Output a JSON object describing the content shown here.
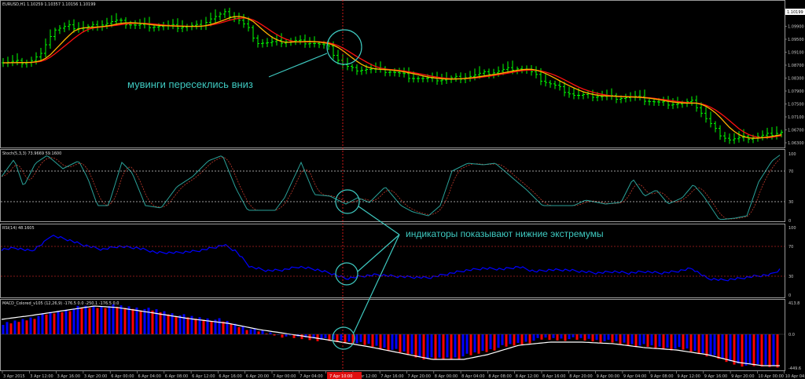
{
  "header": {
    "symbol_title": "EURUSD,H1  1.10259 1.10357 1.10156 1.10199"
  },
  "price_pane": {
    "current_price_badge": "1.10199",
    "price_axis": [
      "1.10300",
      "1.09900",
      "1.09500",
      "1.09100",
      "1.08700",
      "1.08300",
      "1.07900",
      "1.07500",
      "1.07100",
      "1.06700",
      "1.06300"
    ],
    "annotation": "мувинги пересеклись вниз"
  },
  "stoch_pane": {
    "title": "Stoch(5,3,3) 73.9669 59.1600",
    "levels": [
      "100",
      "70",
      "30",
      "0"
    ]
  },
  "rsi_pane": {
    "title": "RSI(14) 48.1605",
    "levels": [
      "100",
      "70",
      "30",
      "0"
    ]
  },
  "macd_pane": {
    "title": "MACD_Colored_v105 (12,26,9) -176.5 0.0 -250.1 -176.5 0.0",
    "levels": [
      "413.8",
      "0.0",
      "-449.6"
    ]
  },
  "indicators_annotation": "индикаторы показывают нижние экстремумы",
  "time_axis": [
    "3 Apr 2015",
    "3 Apr 12:00",
    "3 Apr 16:00",
    "3 Apr 20:00",
    "6 Apr 00:00",
    "6 Apr 04:00",
    "6 Apr 08:00",
    "6 Apr 12:00",
    "6 Apr 16:00",
    "6 Apr 20:00",
    "7 Apr 00:00",
    "7 Apr 04:00",
    "7 Apr 08:00",
    "7 Apr 12:00",
    "7 Apr 16:00",
    "7 Apr 20:00",
    "8 Apr 00:00",
    "8 Apr 04:00",
    "8 Apr 08:00",
    "8 Apr 12:00",
    "8 Apr 16:00",
    "8 Apr 20:00",
    "9 Apr 00:00",
    "9 Apr 04:00",
    "9 Apr 08:00",
    "9 Apr 12:00",
    "9 Apr 16:00",
    "9 Apr 20:00",
    "10 Apr 00:00",
    "10 Apr 04:00"
  ],
  "cursor_time_label": "7 Apr 10:00",
  "colors": {
    "candle": "#00ff00",
    "ma_fast": "#ffb000",
    "ma_slow": "#ff1010",
    "stoch_main": "#2aa198",
    "stoch_signal": "#c0392b",
    "rsi": "#0000ff",
    "macd_up": "#0000ff",
    "macd_down": "#ff0000",
    "macd_signal": "#ffffff",
    "annotation": "#3ec9c0"
  }
}
